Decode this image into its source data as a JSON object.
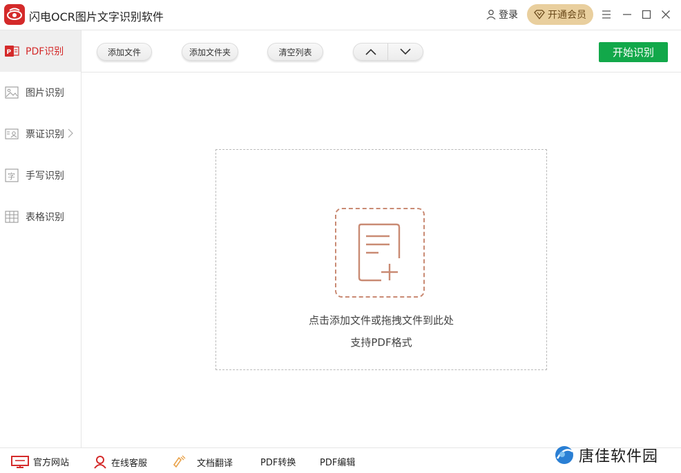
{
  "app": {
    "title": "闪电OCR图片文字识别软件"
  },
  "header": {
    "login_label": "登录",
    "vip_label": "开通会员"
  },
  "sidebar": {
    "items": [
      {
        "label": "PDF识别",
        "icon": "pdf-icon",
        "active": true
      },
      {
        "label": "图片识别",
        "icon": "image-icon"
      },
      {
        "label": "票证识别",
        "icon": "id-card-icon"
      },
      {
        "label": "手写识别",
        "icon": "handwriting-icon"
      },
      {
        "label": "表格识别",
        "icon": "table-icon"
      }
    ]
  },
  "toolbar": {
    "add_file": "添加文件",
    "add_folder": "添加文件夹",
    "clear_list": "清空列表",
    "start": "开始识别"
  },
  "dropzone": {
    "hint": "点击添加文件或拖拽文件到此处",
    "formats": "支持PDF格式"
  },
  "footer": {
    "website": "官方网站",
    "service": "在线客服",
    "translate": "文档翻译",
    "pdf_convert": "PDF转换",
    "pdf_edit": "PDF编辑"
  },
  "watermark": {
    "text": "唐佳软件园"
  },
  "colors": {
    "brand_red": "#d42a2a",
    "start_green": "#12a84a",
    "vip_gold": "#e9cf9e",
    "drop_accent": "#c98a73"
  }
}
